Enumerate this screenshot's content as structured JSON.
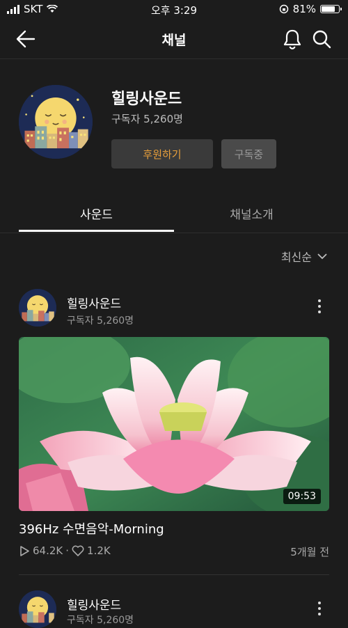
{
  "status": {
    "carrier": "SKT",
    "time": "오후 3:29",
    "battery": "81%",
    "battery_level": 0.81
  },
  "header": {
    "title": "채널"
  },
  "channel": {
    "name": "힐링사운드",
    "subscribers": "구독자 5,260명",
    "sponsor_label": "후원하기",
    "subscribed_label": "구독중"
  },
  "tabs": {
    "sound": "사운드",
    "intro": "채널소개"
  },
  "sort": {
    "label": "최신순"
  },
  "posts": [
    {
      "channel_name": "힐링사운드",
      "subscribers": "구독자 5,260명",
      "duration": "09:53",
      "title": "396Hz 수면음악-Morning",
      "plays": "64.2K",
      "likes": "1.2K",
      "date": "5개월 전"
    },
    {
      "channel_name": "힐링사운드",
      "subscribers": "구독자 5,260명"
    }
  ],
  "colors": {
    "background": "#1c1c1c",
    "accent": "#e9a03b"
  }
}
